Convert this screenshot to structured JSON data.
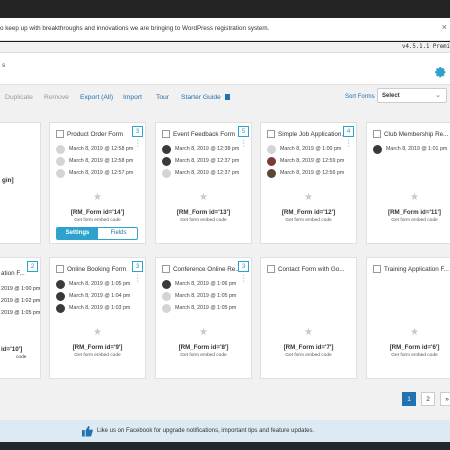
{
  "notice": {
    "text": "o keep up with breakthroughs and innovations we are bringing to WordPress registration system.",
    "close": "×"
  },
  "version": "v4.5.1.1 Premi",
  "header": {
    "title_fragment": "s"
  },
  "toolbar": {
    "duplicate": "Duplicate",
    "remove": "Remove",
    "export": "Export (All)",
    "import": "Import",
    "tour": "Tour",
    "starter_guide": "Starter Guide",
    "sort_label": "Sort Forms",
    "sort_value": "Select"
  },
  "side_left_top": "gin]",
  "side_left_bottom": [
    {
      "title": "ation F...",
      "badge": "2",
      "dates": [
        "2019 @ 1:00 pm",
        "2019 @ 1:02 pm",
        "2019 @ 1:05 pm"
      ],
      "shortcode": "id='10']",
      "embed": "code"
    }
  ],
  "cards_top": [
    {
      "title": "Product Order Form",
      "badge": "3",
      "dates": [
        "March 8, 2019 @ 12:58 pm",
        "March 8, 2019 @ 12:58 pm",
        "March 8, 2019 @ 12:57 pm"
      ],
      "avatars": [
        "gray",
        "gray",
        "gray"
      ],
      "shortcode": "[RM_Form id='14']",
      "embed": "Get form embed code",
      "seg_a": "Settings",
      "seg_b": "Fields"
    },
    {
      "title": "Event Feedback Form",
      "badge": "5",
      "dates": [
        "March 8, 2019 @ 12:38 pm",
        "March 8, 2019 @ 12:37 pm",
        "March 8, 2019 @ 12:37 pm"
      ],
      "avatars": [
        "dark",
        "dark",
        "gray"
      ],
      "shortcode": "[RM_Form id='13']",
      "embed": "Get form embed code"
    },
    {
      "title": "Simple Job Application...",
      "badge": "4",
      "dates": [
        "March 8, 2019 @ 1:00 pm",
        "March 8, 2019 @ 12:59 pm",
        "March 8, 2019 @ 12:56 pm"
      ],
      "avatars": [
        "gray",
        "red",
        "brown"
      ],
      "shortcode": "[RM_Form id='12']",
      "embed": "Get form embed code"
    },
    {
      "title": "Club Membership Re...",
      "badge": "",
      "dates": [
        "March 8, 2019 @ 1:01 pm"
      ],
      "avatars": [
        "dark"
      ],
      "shortcode": "[RM_Form id='11']",
      "embed": "Get form embed code"
    }
  ],
  "cards_bottom": [
    {
      "title": "Online Booking Form",
      "badge": "3",
      "dates": [
        "March 8, 2019 @ 1:05 pm",
        "March 8, 2019 @ 1:04 pm",
        "March 8, 2019 @ 1:03 pm"
      ],
      "avatars": [
        "dark",
        "dark",
        "dark"
      ],
      "shortcode": "[RM_Form id='9']",
      "embed": "Get form embed code"
    },
    {
      "title": "Conference Online Re...",
      "badge": "3",
      "dates": [
        "March 8, 2019 @ 1:06 pm",
        "March 8, 2019 @ 1:05 pm",
        "March 8, 2019 @ 1:05 pm"
      ],
      "avatars": [
        "dark",
        "gray",
        "gray"
      ],
      "shortcode": "[RM_Form id='8']",
      "embed": "Get form embed code"
    },
    {
      "title": "Contact Form with Go...",
      "badge": "",
      "dates": [],
      "avatars": [],
      "shortcode": "[RM_Form id='7']",
      "embed": "Get form embed code"
    },
    {
      "title": "Training Application F...",
      "badge": "",
      "dates": [],
      "avatars": [],
      "shortcode": "[RM_Form id='6']",
      "embed": "Get form embed code"
    }
  ],
  "pagination": {
    "pages": [
      "1",
      "2",
      "»"
    ],
    "active": "1"
  },
  "footer": {
    "text": "Like us on Facebook for upgrade notifications, important tips and feature updates."
  },
  "colors": {
    "accent": "#2ea2cc",
    "link": "#2271b1",
    "footer_bg": "#dceaf3",
    "main_bg": "#f1f1f1"
  }
}
